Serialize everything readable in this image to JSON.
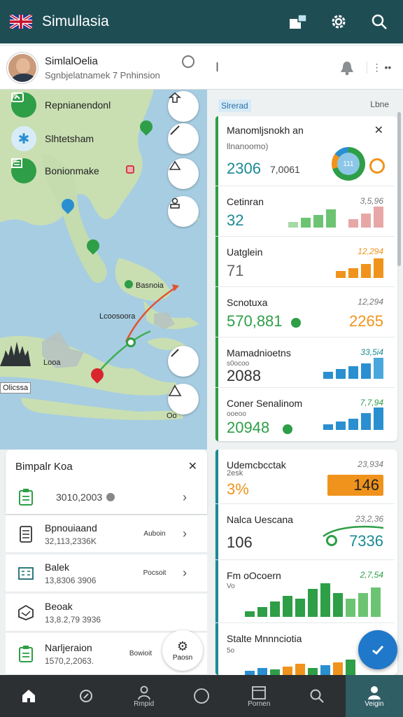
{
  "app": {
    "title": "Simullasia"
  },
  "colors": {
    "topbar": "#1f4d54",
    "green": "#2e9e47",
    "orange": "#f0931c",
    "teal": "#1b8a94",
    "blue": "#2a8fd0"
  },
  "profile": {
    "name": "SimlalOelia",
    "subtitle": "Sgnbjelatnamek 7 Pnhinsion",
    "cursor": "I",
    "more": "⋮ ••"
  },
  "map": {
    "legend": [
      {
        "label": "Repnianendonl",
        "icon": "route-icon"
      },
      {
        "label": "Slhtetsham",
        "icon": "plane-icon"
      },
      {
        "label": "Bonionmake",
        "icon": "list-icon"
      }
    ],
    "labels": {
      "city1": "Basnoia",
      "city2": "Lcoosoora",
      "city3": "Looa",
      "city4": "Olicssa",
      "city5": "Oo"
    }
  },
  "right": {
    "chip": "Slrerad",
    "chip_right": "Lbne",
    "card1": {
      "title": "Manomljsnokh an",
      "sub": "llnanoomo)",
      "value": "2306",
      "value2": "7,0061",
      "donut_center": "111"
    },
    "metrics": [
      {
        "title": "Cetinran",
        "value": "32",
        "side": "3,5,96",
        "color": "#1b8a94"
      },
      {
        "title": "Uatglein",
        "value": "71",
        "side": "12,294",
        "color": "#666666"
      },
      {
        "title": "Scnotuxa",
        "value": "570,881",
        "side": "12,294",
        "right_value": "2265",
        "color": "#2e9e47"
      },
      {
        "title": "Mamadnioetns",
        "value": "2088",
        "sub": "s0ocoo",
        "side": "33,5i4",
        "color": "#333333"
      },
      {
        "title": "Coner Senalinom",
        "value": "20948",
        "sub": "ooeoo",
        "side": "7,7,94",
        "color": "#2e9e47"
      }
    ],
    "card3": [
      {
        "title": "Udemcbcctak",
        "sub": "2esk",
        "value": "3%",
        "side": "23,934",
        "right_value": "146"
      },
      {
        "title": "Nalca Uescana",
        "value": "106",
        "side": "23,2,36",
        "right_value": "7336"
      },
      {
        "title": "Fm oOcoern",
        "sub": "Vo",
        "side": "2,7,54"
      },
      {
        "title": "Stalte Mnnnciotia",
        "sub": "5o",
        "side": ""
      }
    ]
  },
  "sheet": {
    "title": "Bimpalr Koa",
    "first": {
      "value": "3010,2003"
    },
    "rows": [
      {
        "title": "Bpnouiaand",
        "sub": "32,113,2336K",
        "tag": "Auboin",
        "icon": "doc-icon"
      },
      {
        "title": "Balek",
        "sub": "13,8306 3906",
        "tag": "Pocsoit",
        "icon": "building-icon"
      },
      {
        "title": "Beoak",
        "sub": "13,8.2,79 3936",
        "tag": "",
        "icon": "box-icon"
      },
      {
        "title": "Narljeraion",
        "sub": "1570,2,2063.",
        "tag": "Bowioit",
        "icon": "clipboard-icon"
      }
    ],
    "float_label": "Paosn"
  },
  "nav": [
    {
      "label": "",
      "icon": "home-icon"
    },
    {
      "label": "",
      "icon": "location-icon"
    },
    {
      "label": "Rmpid",
      "icon": "person-icon"
    },
    {
      "label": "",
      "icon": "circle-icon"
    },
    {
      "label": "Pornen",
      "icon": "calendar-icon"
    },
    {
      "label": "",
      "icon": "search-icon"
    },
    {
      "label": "Veigin",
      "icon": "profile-icon"
    }
  ]
}
